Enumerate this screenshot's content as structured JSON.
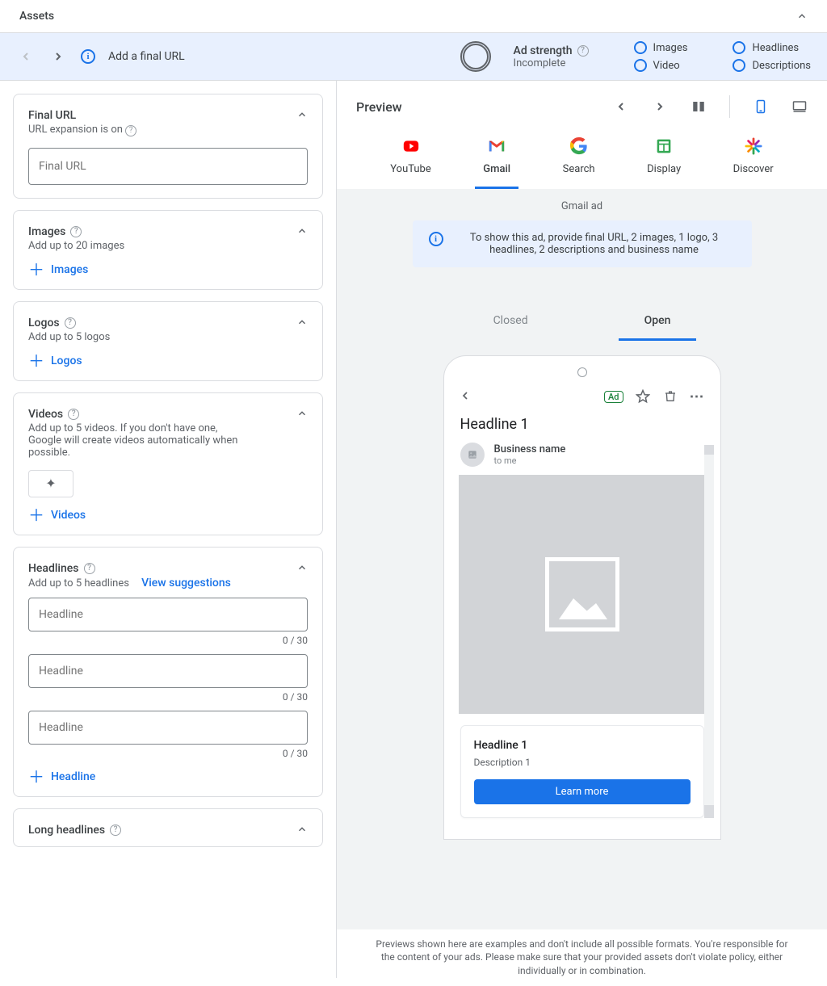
{
  "header": {
    "title": "Assets"
  },
  "strengthBar": {
    "hint": "Add a final URL",
    "label": "Ad strength",
    "status": "Incomplete",
    "checks": {
      "images": "Images",
      "video": "Video",
      "headlines": "Headlines",
      "descriptions": "Descriptions"
    }
  },
  "cards": {
    "finalUrl": {
      "title": "Final URL",
      "sub": "URL expansion is on",
      "placeholder": "Final URL"
    },
    "images": {
      "title": "Images",
      "sub": "Add up to 20 images",
      "add": "Images"
    },
    "logos": {
      "title": "Logos",
      "sub": "Add up to 5 logos",
      "add": "Logos"
    },
    "videos": {
      "title": "Videos",
      "sub": "Add up to 5 videos. If you don't have one, Google will create videos automatically when possible.",
      "add": "Videos"
    },
    "headlines": {
      "title": "Headlines",
      "sub": "Add up to 5 headlines",
      "suggest": "View suggestions",
      "inputs": [
        {
          "placeholder": "Headline",
          "counter": "0 / 30"
        },
        {
          "placeholder": "Headline",
          "counter": "0 / 30"
        },
        {
          "placeholder": "Headline",
          "counter": "0 / 30"
        }
      ],
      "add": "Headline"
    },
    "longHeadlines": {
      "title": "Long headlines"
    }
  },
  "preview": {
    "title": "Preview",
    "channels": {
      "youtube": "YouTube",
      "gmail": "Gmail",
      "search": "Search",
      "display": "Display",
      "discover": "Discover"
    },
    "stageTitle": "Gmail ad",
    "bannerText": "To show this ad, provide final URL, 2 images, 1 logo, 3 headlines, 2 descriptions and business name",
    "stateTabs": {
      "closed": "Closed",
      "open": "Open"
    },
    "email": {
      "adBadge": "Ad",
      "headline": "Headline 1",
      "business": "Business name",
      "to": "to me",
      "cardHeadline": "Headline 1",
      "cardDesc": "Description 1",
      "cta": "Learn more"
    },
    "disclaimer": "Previews shown here are examples and don't include all possible formats. You're responsible for the content of your ads. Please make sure that your provided assets don't violate policy, either individually or in combination."
  }
}
